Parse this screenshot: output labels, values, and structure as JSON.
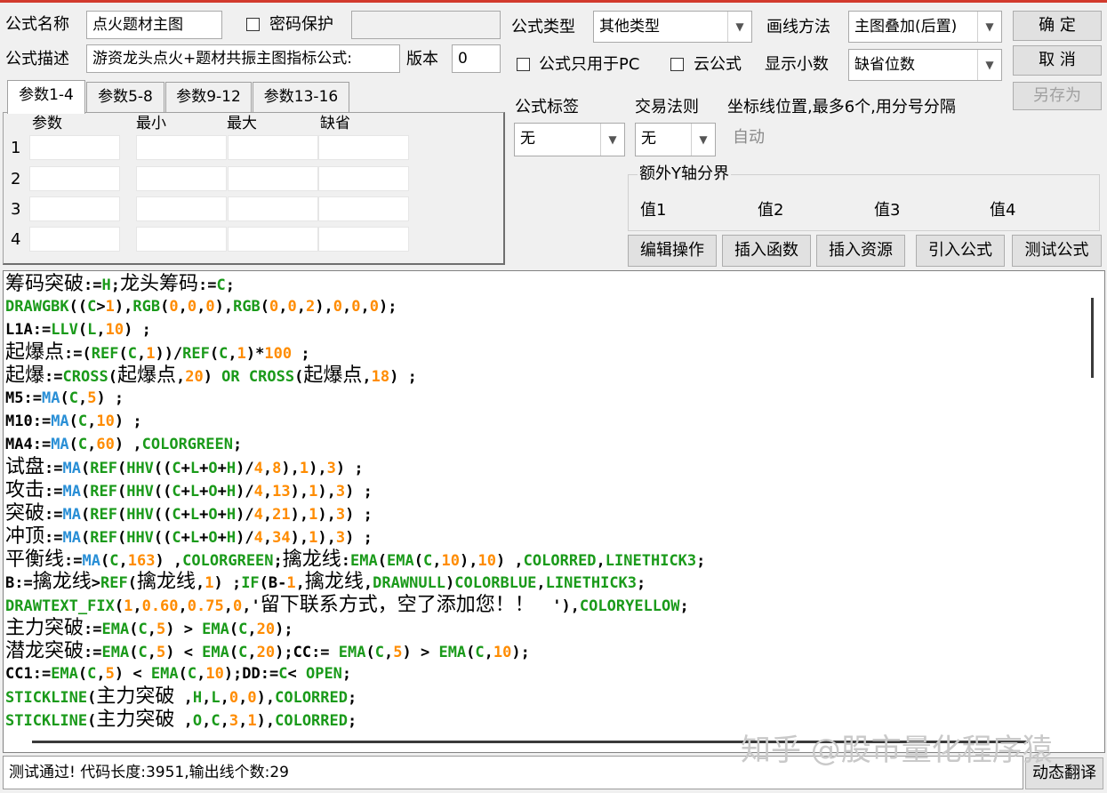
{
  "form": {
    "name_label": "公式名称",
    "name_value": "点火题材主图",
    "password_label": "密码保护",
    "desc_label": "公式描述",
    "desc_value": "游资龙头点火+题材共振主图指标公式:",
    "version_label": "版本",
    "version_value": "0",
    "type_label": "公式类型",
    "type_value": "其他类型",
    "draw_label": "画线方法",
    "draw_value": "主图叠加(后置)",
    "pc_only_label": "公式只用于PC",
    "cloud_label": "云公式",
    "decimal_label": "显示小数",
    "decimal_value": "缺省位数",
    "tag_label": "公式标签",
    "tag_value": "无",
    "trade_label": "交易法则",
    "trade_value": "无",
    "coord_label": "坐标线位置,最多6个,用分号分隔",
    "coord_value": "自动",
    "extra_y_label": "额外Y轴分界",
    "y_values": [
      "值1",
      "值2",
      "值3",
      "值4"
    ]
  },
  "buttons": {
    "ok": "确  定",
    "cancel": "取  消",
    "save_as": "另存为",
    "edit": "编辑操作",
    "insert_func": "插入函数",
    "insert_res": "插入资源",
    "import": "引入公式",
    "test": "测试公式",
    "translate": "动态翻译"
  },
  "tabs": [
    "参数1-4",
    "参数5-8",
    "参数9-12",
    "参数13-16"
  ],
  "param_headers": [
    "参数",
    "最小",
    "最大",
    "缺省"
  ],
  "param_rows": [
    "1",
    "2",
    "3",
    "4"
  ],
  "colors": {
    "cn": "#000000",
    "kw": "#1a9a1a",
    "num": "#ff8c00",
    "fn": "#2a8fd6",
    "sym": "#000000"
  },
  "code_lines": [
    [
      [
        "cn",
        "筹码突破"
      ],
      [
        "sym",
        ":="
      ],
      [
        "kw",
        "H"
      ],
      [
        "sym",
        ";"
      ],
      [
        "cn",
        "龙头筹码"
      ],
      [
        "sym",
        ":="
      ],
      [
        "kw",
        "C"
      ],
      [
        "sym",
        ";"
      ]
    ],
    [
      [
        "kw",
        "DRAWGBK"
      ],
      [
        "sym",
        "(("
      ],
      [
        "kw",
        "C"
      ],
      [
        "sym",
        ">"
      ],
      [
        "num",
        "1"
      ],
      [
        "sym",
        "),"
      ],
      [
        "kw",
        "RGB"
      ],
      [
        "sym",
        "("
      ],
      [
        "num",
        "0"
      ],
      [
        "sym",
        ","
      ],
      [
        "num",
        "0"
      ],
      [
        "sym",
        ","
      ],
      [
        "num",
        "0"
      ],
      [
        "sym",
        "),"
      ],
      [
        "kw",
        "RGB"
      ],
      [
        "sym",
        "("
      ],
      [
        "num",
        "0"
      ],
      [
        "sym",
        ","
      ],
      [
        "num",
        "0"
      ],
      [
        "sym",
        ","
      ],
      [
        "num",
        "2"
      ],
      [
        "sym",
        "),"
      ],
      [
        "num",
        "0"
      ],
      [
        "sym",
        ","
      ],
      [
        "num",
        "0"
      ],
      [
        "sym",
        ","
      ],
      [
        "num",
        "0"
      ],
      [
        "sym",
        ");"
      ]
    ],
    [
      [
        "sym",
        "L1A:="
      ],
      [
        "kw",
        "LLV"
      ],
      [
        "sym",
        "("
      ],
      [
        "kw",
        "L"
      ],
      [
        "sym",
        ","
      ],
      [
        "num",
        "10"
      ],
      [
        "sym",
        ") ;"
      ]
    ],
    [
      [
        "cn",
        "起爆点"
      ],
      [
        "sym",
        ":=("
      ],
      [
        "kw",
        "REF"
      ],
      [
        "sym",
        "("
      ],
      [
        "kw",
        "C"
      ],
      [
        "sym",
        ","
      ],
      [
        "num",
        "1"
      ],
      [
        "sym",
        "))/"
      ],
      [
        "kw",
        "REF"
      ],
      [
        "sym",
        "("
      ],
      [
        "kw",
        "C"
      ],
      [
        "sym",
        ","
      ],
      [
        "num",
        "1"
      ],
      [
        "sym",
        ")*"
      ],
      [
        "num",
        "100"
      ],
      [
        "sym",
        " ;"
      ]
    ],
    [
      [
        "cn",
        "起爆"
      ],
      [
        "sym",
        ":="
      ],
      [
        "kw",
        "CROSS"
      ],
      [
        "sym",
        "("
      ],
      [
        "cn",
        "起爆点"
      ],
      [
        "sym",
        ","
      ],
      [
        "num",
        "20"
      ],
      [
        "sym",
        ") "
      ],
      [
        "kw",
        "OR"
      ],
      [
        "sym",
        " "
      ],
      [
        "kw",
        "CROSS"
      ],
      [
        "sym",
        "("
      ],
      [
        "cn",
        "起爆点"
      ],
      [
        "sym",
        ","
      ],
      [
        "num",
        "18"
      ],
      [
        "sym",
        ") ;"
      ]
    ],
    [
      [
        "sym",
        "M5:="
      ],
      [
        "fn",
        "MA"
      ],
      [
        "sym",
        "("
      ],
      [
        "kw",
        "C"
      ],
      [
        "sym",
        ","
      ],
      [
        "num",
        "5"
      ],
      [
        "sym",
        ") ;"
      ]
    ],
    [
      [
        "sym",
        "M10:="
      ],
      [
        "fn",
        "MA"
      ],
      [
        "sym",
        "("
      ],
      [
        "kw",
        "C"
      ],
      [
        "sym",
        ","
      ],
      [
        "num",
        "10"
      ],
      [
        "sym",
        ") ;"
      ]
    ],
    [
      [
        "sym",
        "MA4:="
      ],
      [
        "fn",
        "MA"
      ],
      [
        "sym",
        "("
      ],
      [
        "kw",
        "C"
      ],
      [
        "sym",
        ","
      ],
      [
        "num",
        "60"
      ],
      [
        "sym",
        ") ,"
      ],
      [
        "kw",
        "COLORGREEN"
      ],
      [
        "sym",
        ";"
      ]
    ],
    [
      [
        "cn",
        "试盘"
      ],
      [
        "sym",
        ":="
      ],
      [
        "fn",
        "MA"
      ],
      [
        "sym",
        "("
      ],
      [
        "kw",
        "REF"
      ],
      [
        "sym",
        "("
      ],
      [
        "kw",
        "HHV"
      ],
      [
        "sym",
        "(("
      ],
      [
        "kw",
        "C"
      ],
      [
        "sym",
        "+"
      ],
      [
        "kw",
        "L"
      ],
      [
        "sym",
        "+"
      ],
      [
        "kw",
        "O"
      ],
      [
        "sym",
        "+"
      ],
      [
        "kw",
        "H"
      ],
      [
        "sym",
        ")/"
      ],
      [
        "num",
        "4"
      ],
      [
        "sym",
        ","
      ],
      [
        "num",
        "8"
      ],
      [
        "sym",
        "),"
      ],
      [
        "num",
        "1"
      ],
      [
        "sym",
        "),"
      ],
      [
        "num",
        "3"
      ],
      [
        "sym",
        ") ;"
      ]
    ],
    [
      [
        "cn",
        "攻击"
      ],
      [
        "sym",
        ":="
      ],
      [
        "fn",
        "MA"
      ],
      [
        "sym",
        "("
      ],
      [
        "kw",
        "REF"
      ],
      [
        "sym",
        "("
      ],
      [
        "kw",
        "HHV"
      ],
      [
        "sym",
        "(("
      ],
      [
        "kw",
        "C"
      ],
      [
        "sym",
        "+"
      ],
      [
        "kw",
        "L"
      ],
      [
        "sym",
        "+"
      ],
      [
        "kw",
        "O"
      ],
      [
        "sym",
        "+"
      ],
      [
        "kw",
        "H"
      ],
      [
        "sym",
        ")/"
      ],
      [
        "num",
        "4"
      ],
      [
        "sym",
        ","
      ],
      [
        "num",
        "13"
      ],
      [
        "sym",
        "),"
      ],
      [
        "num",
        "1"
      ],
      [
        "sym",
        "),"
      ],
      [
        "num",
        "3"
      ],
      [
        "sym",
        ") ;"
      ]
    ],
    [
      [
        "cn",
        "突破"
      ],
      [
        "sym",
        ":="
      ],
      [
        "fn",
        "MA"
      ],
      [
        "sym",
        "("
      ],
      [
        "kw",
        "REF"
      ],
      [
        "sym",
        "("
      ],
      [
        "kw",
        "HHV"
      ],
      [
        "sym",
        "(("
      ],
      [
        "kw",
        "C"
      ],
      [
        "sym",
        "+"
      ],
      [
        "kw",
        "L"
      ],
      [
        "sym",
        "+"
      ],
      [
        "kw",
        "O"
      ],
      [
        "sym",
        "+"
      ],
      [
        "kw",
        "H"
      ],
      [
        "sym",
        ")/"
      ],
      [
        "num",
        "4"
      ],
      [
        "sym",
        ","
      ],
      [
        "num",
        "21"
      ],
      [
        "sym",
        "),"
      ],
      [
        "num",
        "1"
      ],
      [
        "sym",
        "),"
      ],
      [
        "num",
        "3"
      ],
      [
        "sym",
        ") ;"
      ]
    ],
    [
      [
        "cn",
        "冲顶"
      ],
      [
        "sym",
        ":="
      ],
      [
        "fn",
        "MA"
      ],
      [
        "sym",
        "("
      ],
      [
        "kw",
        "REF"
      ],
      [
        "sym",
        "("
      ],
      [
        "kw",
        "HHV"
      ],
      [
        "sym",
        "(("
      ],
      [
        "kw",
        "C"
      ],
      [
        "sym",
        "+"
      ],
      [
        "kw",
        "L"
      ],
      [
        "sym",
        "+"
      ],
      [
        "kw",
        "O"
      ],
      [
        "sym",
        "+"
      ],
      [
        "kw",
        "H"
      ],
      [
        "sym",
        ")/"
      ],
      [
        "num",
        "4"
      ],
      [
        "sym",
        ","
      ],
      [
        "num",
        "34"
      ],
      [
        "sym",
        "),"
      ],
      [
        "num",
        "1"
      ],
      [
        "sym",
        "),"
      ],
      [
        "num",
        "3"
      ],
      [
        "sym",
        ") ;"
      ]
    ],
    [
      [
        "cn",
        "平衡线"
      ],
      [
        "sym",
        ":="
      ],
      [
        "fn",
        "MA"
      ],
      [
        "sym",
        "("
      ],
      [
        "kw",
        "C"
      ],
      [
        "sym",
        ","
      ],
      [
        "num",
        "163"
      ],
      [
        "sym",
        ") ,"
      ],
      [
        "kw",
        "COLORGREEN"
      ],
      [
        "sym",
        ";"
      ],
      [
        "cn",
        "擒龙线"
      ],
      [
        "sym",
        ":"
      ],
      [
        "kw",
        "EMA"
      ],
      [
        "sym",
        "("
      ],
      [
        "kw",
        "EMA"
      ],
      [
        "sym",
        "("
      ],
      [
        "kw",
        "C"
      ],
      [
        "sym",
        ","
      ],
      [
        "num",
        "10"
      ],
      [
        "sym",
        "),"
      ],
      [
        "num",
        "10"
      ],
      [
        "sym",
        ") ,"
      ],
      [
        "kw",
        "COLORRED"
      ],
      [
        "sym",
        ","
      ],
      [
        "kw",
        "LINETHICK3"
      ],
      [
        "sym",
        ";"
      ]
    ],
    [
      [
        "sym",
        "B:="
      ],
      [
        "cn",
        "擒龙线"
      ],
      [
        "sym",
        ">"
      ],
      [
        "kw",
        "REF"
      ],
      [
        "sym",
        "("
      ],
      [
        "cn",
        "擒龙线"
      ],
      [
        "sym",
        ","
      ],
      [
        "num",
        "1"
      ],
      [
        "sym",
        ") ;"
      ],
      [
        "kw",
        "IF"
      ],
      [
        "sym",
        "(B-"
      ],
      [
        "num",
        "1"
      ],
      [
        "sym",
        ","
      ],
      [
        "cn",
        "擒龙线"
      ],
      [
        "sym",
        ","
      ],
      [
        "kw",
        "DRAWNULL"
      ],
      [
        "sym",
        ")"
      ],
      [
        "kw",
        "COLORBLUE"
      ],
      [
        "sym",
        ","
      ],
      [
        "kw",
        "LINETHICK3"
      ],
      [
        "sym",
        ";"
      ]
    ],
    [
      [
        "kw",
        "DRAWTEXT_FIX"
      ],
      [
        "sym",
        "("
      ],
      [
        "num",
        "1"
      ],
      [
        "sym",
        ","
      ],
      [
        "num",
        "0.60"
      ],
      [
        "sym",
        ","
      ],
      [
        "num",
        "0.75"
      ],
      [
        "sym",
        ","
      ],
      [
        "num",
        "0"
      ],
      [
        "sym",
        ",'"
      ],
      [
        "cn",
        "留下联系方式，空了添加您！！"
      ],
      [
        "sym",
        "  '),"
      ],
      [
        "kw",
        "COLORYELLOW"
      ],
      [
        "sym",
        ";"
      ]
    ],
    [
      [
        "cn",
        "主力突破"
      ],
      [
        "sym",
        ":="
      ],
      [
        "kw",
        "EMA"
      ],
      [
        "sym",
        "("
      ],
      [
        "kw",
        "C"
      ],
      [
        "sym",
        ","
      ],
      [
        "num",
        "5"
      ],
      [
        "sym",
        ") > "
      ],
      [
        "kw",
        "EMA"
      ],
      [
        "sym",
        "("
      ],
      [
        "kw",
        "C"
      ],
      [
        "sym",
        ","
      ],
      [
        "num",
        "20"
      ],
      [
        "sym",
        ");"
      ]
    ],
    [
      [
        "cn",
        "潜龙突破"
      ],
      [
        "sym",
        ":="
      ],
      [
        "kw",
        "EMA"
      ],
      [
        "sym",
        "("
      ],
      [
        "kw",
        "C"
      ],
      [
        "sym",
        ","
      ],
      [
        "num",
        "5"
      ],
      [
        "sym",
        ") < "
      ],
      [
        "kw",
        "EMA"
      ],
      [
        "sym",
        "("
      ],
      [
        "kw",
        "C"
      ],
      [
        "sym",
        ","
      ],
      [
        "num",
        "20"
      ],
      [
        "sym",
        ");CC:= "
      ],
      [
        "kw",
        "EMA"
      ],
      [
        "sym",
        "("
      ],
      [
        "kw",
        "C"
      ],
      [
        "sym",
        ","
      ],
      [
        "num",
        "5"
      ],
      [
        "sym",
        ") > "
      ],
      [
        "kw",
        "EMA"
      ],
      [
        "sym",
        "("
      ],
      [
        "kw",
        "C"
      ],
      [
        "sym",
        ","
      ],
      [
        "num",
        "10"
      ],
      [
        "sym",
        ");"
      ]
    ],
    [
      [
        "sym",
        "CC1:="
      ],
      [
        "kw",
        "EMA"
      ],
      [
        "sym",
        "("
      ],
      [
        "kw",
        "C"
      ],
      [
        "sym",
        ","
      ],
      [
        "num",
        "5"
      ],
      [
        "sym",
        ") < "
      ],
      [
        "kw",
        "EMA"
      ],
      [
        "sym",
        "("
      ],
      [
        "kw",
        "C"
      ],
      [
        "sym",
        ","
      ],
      [
        "num",
        "10"
      ],
      [
        "sym",
        ");DD:="
      ],
      [
        "kw",
        "C"
      ],
      [
        "sym",
        "< "
      ],
      [
        "kw",
        "OPEN"
      ],
      [
        "sym",
        ";"
      ]
    ],
    [
      [
        "kw",
        "STICKLINE"
      ],
      [
        "sym",
        "("
      ],
      [
        "cn",
        "主力突破"
      ],
      [
        "sym",
        " ,"
      ],
      [
        "kw",
        "H"
      ],
      [
        "sym",
        ","
      ],
      [
        "kw",
        "L"
      ],
      [
        "sym",
        ","
      ],
      [
        "num",
        "0"
      ],
      [
        "sym",
        ","
      ],
      [
        "num",
        "0"
      ],
      [
        "sym",
        "),"
      ],
      [
        "kw",
        "COLORRED"
      ],
      [
        "sym",
        ";"
      ]
    ],
    [
      [
        "kw",
        "STICKLINE"
      ],
      [
        "sym",
        "("
      ],
      [
        "cn",
        "主力突破"
      ],
      [
        "sym",
        " ,"
      ],
      [
        "kw",
        "O"
      ],
      [
        "sym",
        ","
      ],
      [
        "kw",
        "C"
      ],
      [
        "sym",
        ","
      ],
      [
        "num",
        "3"
      ],
      [
        "sym",
        ","
      ],
      [
        "num",
        "1"
      ],
      [
        "sym",
        "),"
      ],
      [
        "kw",
        "COLORRED"
      ],
      [
        "sym",
        ";"
      ]
    ]
  ],
  "status": "测试通过! 代码长度:3951,输出线个数:29",
  "watermark": "知乎 @股市量化程序猿"
}
